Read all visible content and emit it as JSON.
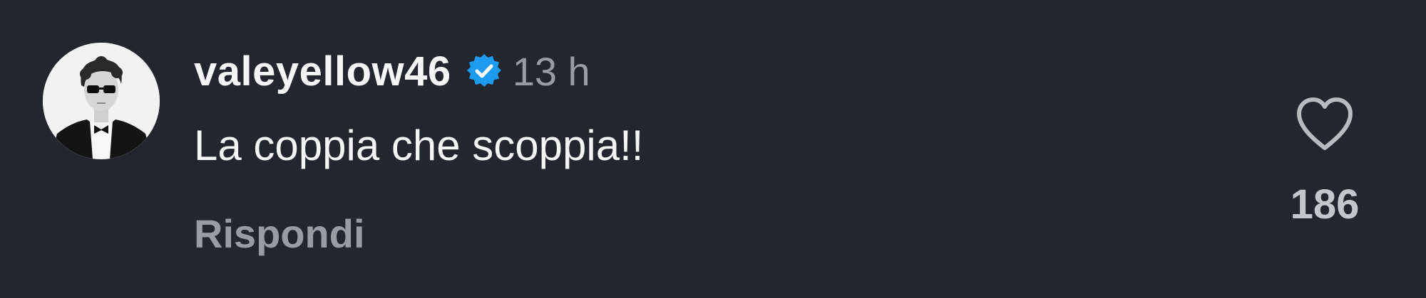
{
  "comment": {
    "username": "valeyellow46",
    "verified": true,
    "time": "13 h",
    "text": "La coppia che scoppia!!",
    "reply_label": "Rispondi",
    "like_count": "186"
  },
  "icons": {
    "verified": "verified-badge-icon",
    "like": "heart-outline-icon"
  },
  "colors": {
    "background": "#23262e",
    "verified_badge": "#1d9bf0",
    "primary_text": "#f5f5f5",
    "secondary_text": "#9a9ca3"
  }
}
